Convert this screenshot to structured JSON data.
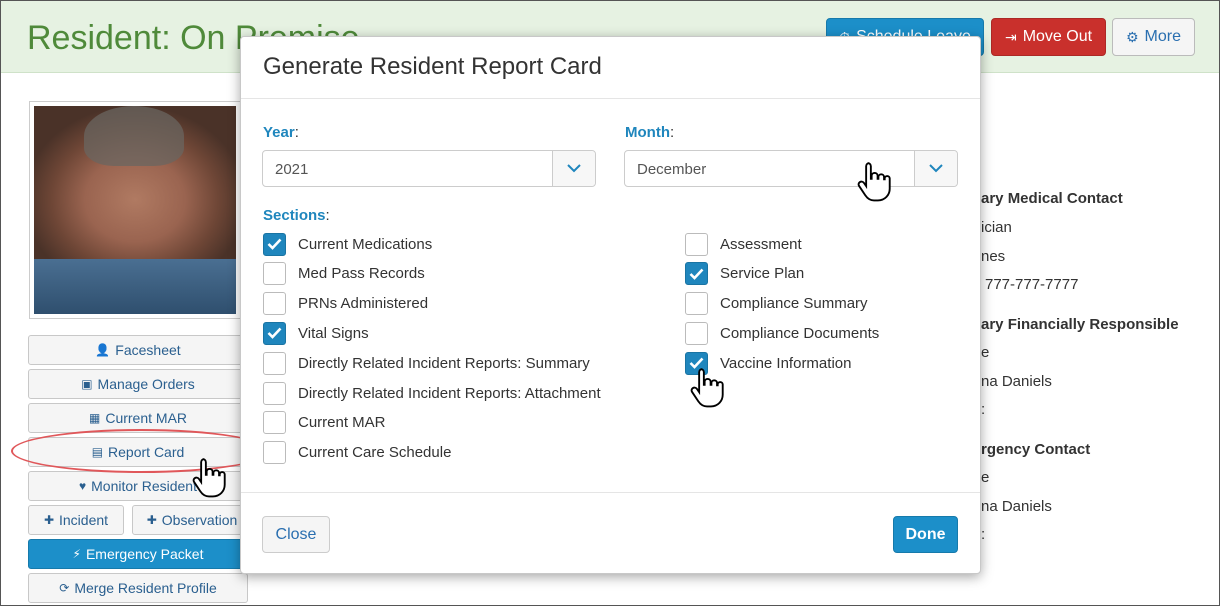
{
  "page": {
    "title": "Resident: On Premise",
    "header_buttons": {
      "schedule_leave": "Schedule Leave",
      "move_out": "Move Out",
      "more": "More"
    }
  },
  "sidebar": {
    "buttons": {
      "facesheet": "Facesheet",
      "manage_orders": "Manage Orders",
      "current_mar": "Current MAR",
      "report_card": "Report Card",
      "monitor_resident": "Monitor Resident",
      "incident": "Incident",
      "observation": "Observation",
      "emergency_packet": "Emergency Packet",
      "merge_resident_profile": "Merge Resident Profile"
    }
  },
  "right_panel": {
    "primary_medical_contact": "ary Medical Contact",
    "physician": "ician",
    "name1": "nes",
    "phone": "777-777-7777",
    "primary_financially_responsible": "ary Financially Responsible",
    "rel1": "e",
    "name2": "na Daniels",
    "blank1": ":",
    "emergency_contact": "rgency Contact",
    "rel2": "e",
    "name3": "na Daniels",
    "blank2": ":"
  },
  "modal": {
    "title": "Generate Resident Report Card",
    "year_label": "Year",
    "year_value": "2021",
    "month_label": "Month",
    "month_value": "December",
    "sections_label": "Sections",
    "sections_left": [
      {
        "label": "Current Medications",
        "checked": true
      },
      {
        "label": "Med Pass Records",
        "checked": false
      },
      {
        "label": "PRNs Administered",
        "checked": false
      },
      {
        "label": "Vital Signs",
        "checked": true
      },
      {
        "label": "Directly Related Incident Reports: Summary",
        "checked": false
      },
      {
        "label": "Directly Related Incident Reports: Attachment",
        "checked": false
      },
      {
        "label": "Current MAR",
        "checked": false
      },
      {
        "label": "Current Care Schedule",
        "checked": false
      }
    ],
    "sections_right": [
      {
        "label": "Assessment",
        "checked": false
      },
      {
        "label": "Service Plan",
        "checked": true
      },
      {
        "label": "Compliance Summary",
        "checked": false
      },
      {
        "label": "Compliance Documents",
        "checked": false
      },
      {
        "label": "Vaccine Information",
        "checked": true
      }
    ],
    "close_label": "Close",
    "done_label": "Done"
  },
  "colors": {
    "accent": "#1f86bd",
    "header_green": "#4f8a3a",
    "danger": "#c9302c",
    "highlight_oval": "#e0575a"
  },
  "icons": {
    "facesheet": "user-icon",
    "manage_orders": "medkit-icon",
    "current_mar": "calendar-icon",
    "report_card": "document-icon",
    "monitor_resident": "heartbeat-icon",
    "incident": "plus-icon",
    "observation": "plus-icon",
    "emergency_packet": "bolt-icon",
    "merge_resident_profile": "refresh-icon",
    "select_caret": "chevron-down-icon",
    "checkbox": "check-icon",
    "cursor": "hand-pointer-icon"
  }
}
